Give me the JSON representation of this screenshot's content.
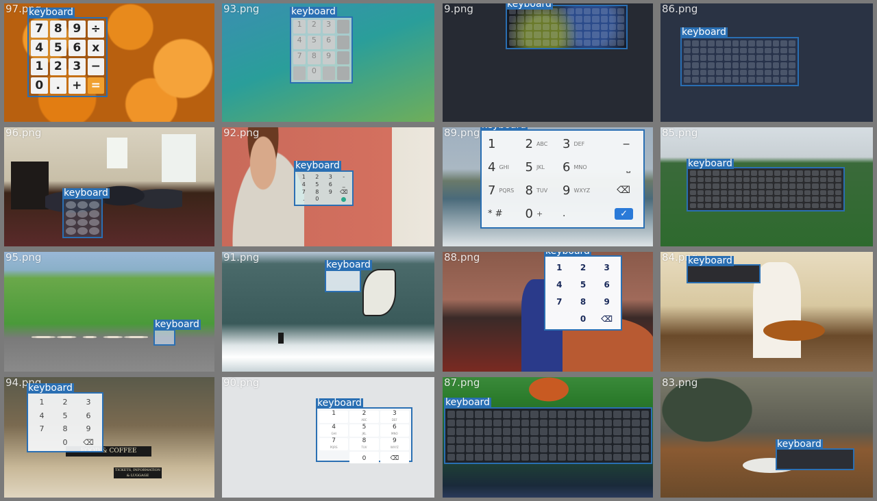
{
  "tiles": [
    {
      "file": "97.png",
      "label": "keyboard"
    },
    {
      "file": "93.png",
      "label": "keyboard"
    },
    {
      "file": "9.png",
      "label": "keyboard"
    },
    {
      "file": "86.png",
      "label": "keyboard"
    },
    {
      "file": "96.png",
      "label": "keyboard"
    },
    {
      "file": "92.png",
      "label": "keyboard"
    },
    {
      "file": "89.png",
      "label": "keyboard"
    },
    {
      "file": "85.png",
      "label": "keyboard"
    },
    {
      "file": "95.png",
      "label": "keyboard"
    },
    {
      "file": "91.png",
      "label": "keyboard"
    },
    {
      "file": "88.png",
      "label": "keyboard"
    },
    {
      "file": "84.png",
      "label": "keyboard"
    },
    {
      "file": "94.png",
      "label": "keyboard"
    },
    {
      "file": "90.png",
      "label": "keyboard"
    },
    {
      "file": "87.png",
      "label": "keyboard"
    },
    {
      "file": "83.png",
      "label": "keyboard"
    }
  ],
  "calc97": [
    "7",
    "8",
    "9",
    "÷",
    "4",
    "5",
    "6",
    "x",
    "1",
    "2",
    "3",
    "−",
    "0",
    ".",
    "+",
    "="
  ],
  "pad93": [
    "1",
    "2",
    "3",
    "",
    "4",
    "5",
    "6",
    "",
    "7",
    "8",
    "9",
    "",
    "",
    "0",
    "",
    ""
  ],
  "pad92": [
    "1",
    "2",
    "3",
    "-",
    "4",
    "5",
    "6",
    "_",
    "7",
    "8",
    "9",
    "⌫",
    ".",
    "0",
    "",
    ""
  ],
  "pad89": [
    {
      "d": "1",
      "s": ""
    },
    {
      "d": "2",
      "s": "ABC"
    },
    {
      "d": "3",
      "s": "DEF"
    },
    {
      "d": "−",
      "s": ""
    },
    {
      "d": "4",
      "s": "GHI"
    },
    {
      "d": "5",
      "s": "JKL"
    },
    {
      "d": "6",
      "s": "MNO"
    },
    {
      "d": "⎵",
      "s": ""
    },
    {
      "d": "7",
      "s": "PQRS"
    },
    {
      "d": "8",
      "s": "TUV"
    },
    {
      "d": "9",
      "s": "WXYZ"
    },
    {
      "d": "⌫",
      "s": ""
    },
    {
      "d": "* #",
      "s": ""
    },
    {
      "d": "0",
      "s": "+"
    },
    {
      "d": ".",
      "s": ""
    },
    {
      "d": "✓",
      "s": ""
    }
  ],
  "pad88": [
    "1",
    "2",
    "3",
    "4",
    "5",
    "6",
    "7",
    "8",
    "9",
    "",
    "0",
    "⌫"
  ],
  "pad94": [
    "1",
    "2",
    "3",
    "4",
    "5",
    "6",
    "7",
    "8",
    "9",
    "",
    "0",
    "⌫"
  ],
  "pad90": [
    {
      "d": "1",
      "s": ""
    },
    {
      "d": "2",
      "s": "ABC"
    },
    {
      "d": "3",
      "s": "DEF"
    },
    {
      "d": "4",
      "s": "GHI"
    },
    {
      "d": "5",
      "s": "JKL"
    },
    {
      "d": "6",
      "s": "MNO"
    },
    {
      "d": "7",
      "s": "PQRS"
    },
    {
      "d": "8",
      "s": "TUV"
    },
    {
      "d": "9",
      "s": "WXYZ"
    },
    {
      "d": "",
      "s": ""
    },
    {
      "d": "0",
      "s": ""
    },
    {
      "d": "⌫",
      "s": ""
    }
  ],
  "signs94": {
    "food": "FOOD & COFFEE",
    "tickets": "TICKETS, INFORMATION & LUGGAGE"
  },
  "colors": {
    "box": "#2a6fb3",
    "label_bg": "#2a6fb3",
    "divider": "#7a7a7a"
  }
}
